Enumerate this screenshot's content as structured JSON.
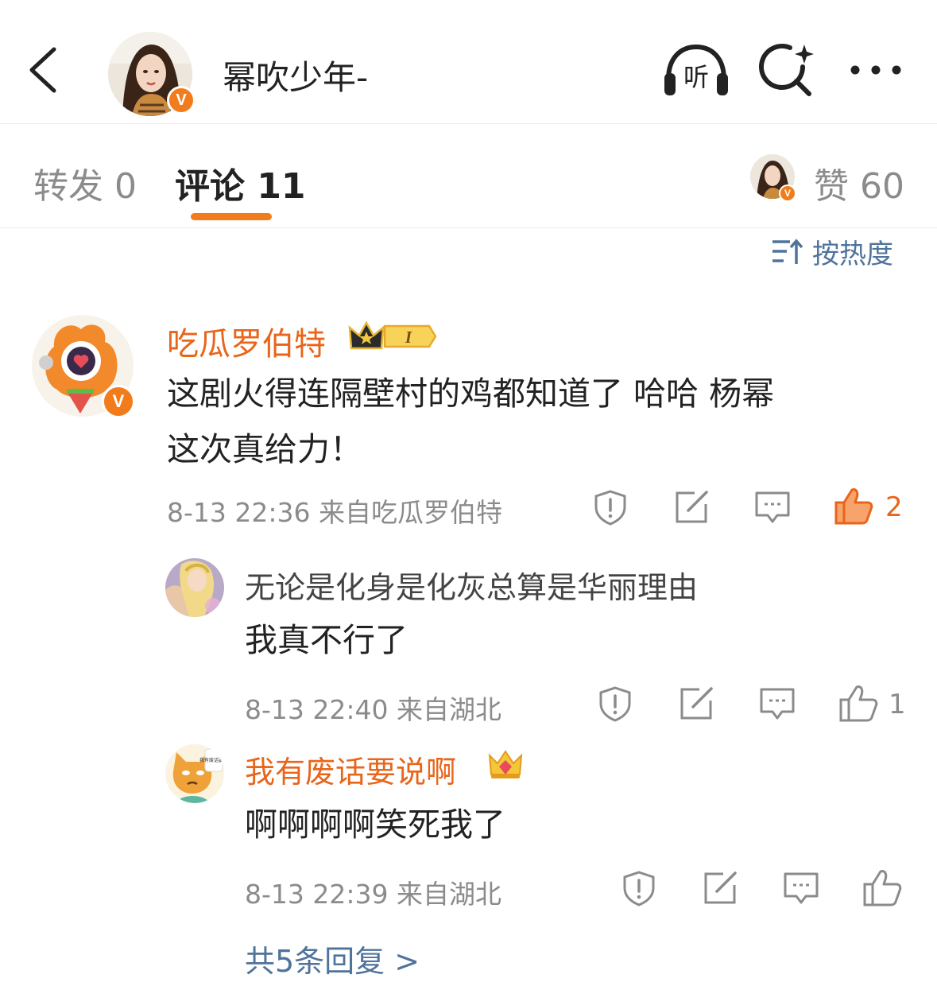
{
  "header": {
    "title": "幂吹少年-",
    "listen_label": "听"
  },
  "tabs": {
    "reposts": "转发 0",
    "comments": "评论 11",
    "likes": "赞 60"
  },
  "sort": {
    "label": "按热度"
  },
  "comments": [
    {
      "username": "吃瓜罗伯特",
      "badge_level": "I",
      "text_line1": "这剧火得连隔壁村的鸡都知道了 哈哈 杨幂",
      "text_line2": "这次真给力！",
      "meta": "8-13 22:36 来自吃瓜罗伯特",
      "likes": "2",
      "liked": true,
      "replies": [
        {
          "username": "无论是化身是化灰总算是华丽理由",
          "text": "我真不行了",
          "meta": "8-13 22:40 来自湖北",
          "likes": "1"
        },
        {
          "username": "我有废话要说啊",
          "text": "啊啊啊啊笑死我了",
          "meta": "8-13 22:39 来自湖北",
          "likes": "",
          "avatar_sign": "我有废话要说"
        }
      ],
      "more_replies": "共5条回复 >"
    }
  ],
  "colors": {
    "accent": "#f27c1c",
    "username": "#e8651a",
    "link": "#50739b",
    "muted": "#8b8b8b"
  },
  "icons": [
    "back-icon",
    "listen-icon",
    "search-icon",
    "more-icon",
    "sort-icon",
    "report-icon",
    "repost-icon",
    "comment-icon",
    "like-icon"
  ]
}
